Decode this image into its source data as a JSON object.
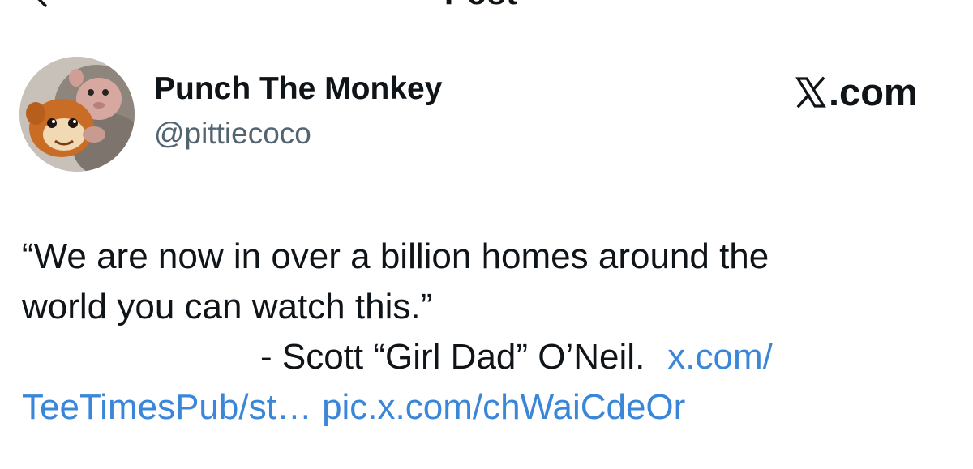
{
  "header": {
    "title": "Post"
  },
  "author": {
    "name": "Punch The Monkey",
    "handle": "@pittiecoco",
    "avatar_icon": "monkey-with-plush-orangutan-avatar"
  },
  "brand": {
    "logo_text": ".com",
    "logo_icon": "x-logo-icon"
  },
  "tweet": {
    "line1": "“We are now in over a billion homes around the",
    "line2": "world you can watch this.”",
    "attribution": "- Scott “Girl Dad” O’Neil.",
    "link1_part1": "x.com/",
    "link1_part2": "TeeTimesPub/st…",
    "link2": "pic.x.com/chWaiCdeOr"
  },
  "colors": {
    "text": "#0f1419",
    "secondary_text": "#536471",
    "link": "#3a86d9"
  }
}
